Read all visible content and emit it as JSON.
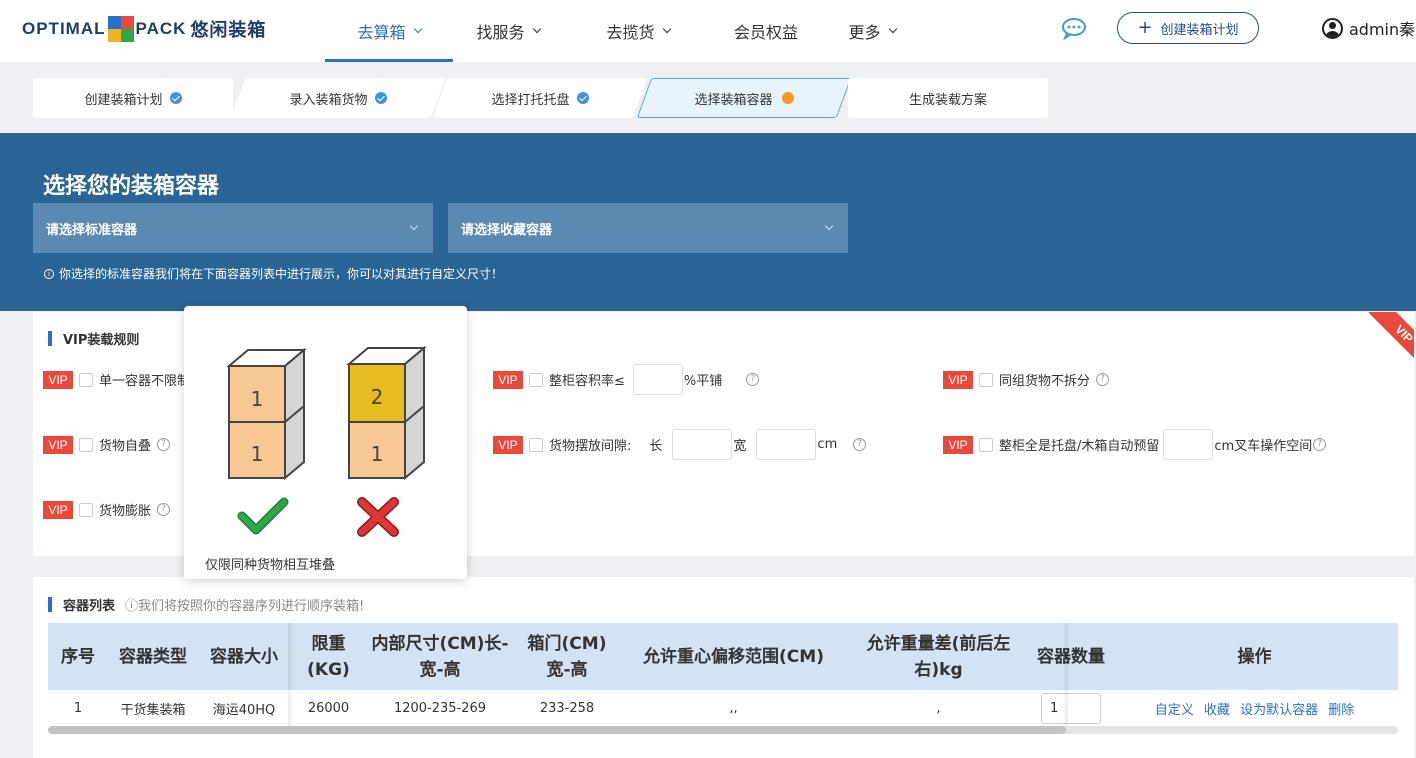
{
  "header": {
    "logo_text_left": "OPTIMAL",
    "logo_text_right": "PACK",
    "logo_cn": "悠闲装箱",
    "nav": [
      {
        "label": "去算箱",
        "dropdown": true,
        "active": true
      },
      {
        "label": "找服务",
        "dropdown": true,
        "active": false
      },
      {
        "label": "去揽货",
        "dropdown": true,
        "active": false
      },
      {
        "label": "会员权益",
        "dropdown": false,
        "active": false
      },
      {
        "label": "更多",
        "dropdown": true,
        "active": false
      }
    ],
    "chat_icon": "chat-bubble-icon",
    "create_button": "创建装箱计划",
    "user": "admin秦"
  },
  "steps": [
    {
      "label": "创建装箱计划",
      "status": "done"
    },
    {
      "label": "录入装箱货物",
      "status": "done"
    },
    {
      "label": "选择打托托盘",
      "status": "done"
    },
    {
      "label": "选择装箱容器",
      "status": "current"
    },
    {
      "label": "生成装载方案",
      "status": "todo"
    }
  ],
  "banner": {
    "title": "选择您的装箱容器",
    "standard_placeholder": "请选择标准容器",
    "favorite_placeholder": "请选择收藏容器",
    "tip": "你选择的标准容器我们将在下面容器列表中进行展示，你可以对其进行自定义尺寸！"
  },
  "vip_rules": {
    "title": "VIP装载规则",
    "tag": "VIP",
    "ribbon": "VIP",
    "rules": {
      "single_container": "单一容器不限制",
      "self_stack": "货物自叠",
      "expand": "货物膨胀",
      "volume_rate_prefix": "整柜容积率≤",
      "volume_rate_suffix": "%平铺",
      "gap_label": "货物摆放间隙:",
      "gap_length": "长",
      "gap_width": "宽",
      "gap_unit": "cm",
      "group_nosplit": "同组货物不拆分",
      "pallet_reserve_prefix": "整柜全是托盘/木箱自动预留",
      "pallet_reserve_suffix": "cm叉车操作空间"
    }
  },
  "popover": {
    "caption": "仅限同种货物相互堆叠",
    "left_stack": [
      "1",
      "1"
    ],
    "right_stack": [
      "2",
      "1"
    ],
    "left_mark": "check-icon",
    "right_mark": "cross-icon",
    "colors": {
      "box": "#f7c894",
      "box_alt": "#e6bd1f",
      "side": "#d5d5d5",
      "ok": "#2aa84a",
      "bad": "#e03535"
    }
  },
  "container_list": {
    "title": "容器列表",
    "note": "ⓘ我们将按照你的容器序列进行顺序装箱!",
    "columns": [
      "序号",
      "容器类型",
      "容器大小",
      "限重(KG)",
      "内部尺寸(CM)长-宽-高",
      "箱门(CM)宽-高",
      "允许重心偏移范围(CM)",
      "允许重量差(前后左右)kg",
      "容器数量",
      "操作"
    ],
    "rows": [
      {
        "index": "1",
        "type": "干货集装箱",
        "size": "海运40HQ",
        "limit": "26000",
        "inner": "1200-235-269",
        "door": "233-258",
        "offset": ",,",
        "weight_diff": ",",
        "qty": "1"
      }
    ],
    "actions": [
      "自定义",
      "收藏",
      "设为默认容器",
      "删除"
    ]
  },
  "colors": {
    "primary": "#2a6fc9",
    "banner": "#2a6494",
    "vip": "#e8493b",
    "header_row": "#d3e3f3"
  }
}
